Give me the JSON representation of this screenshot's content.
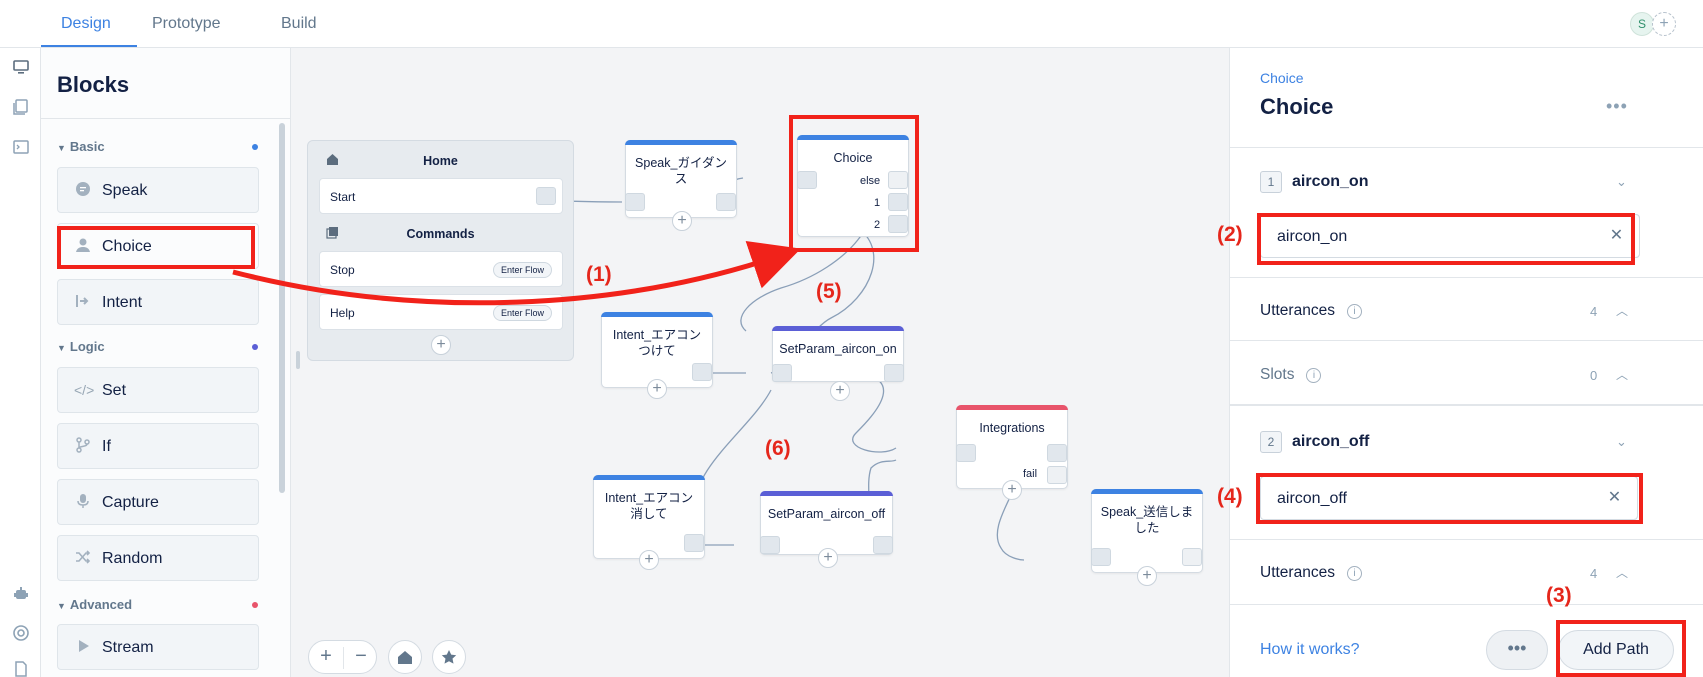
{
  "tabs": [
    {
      "label": "Design",
      "active": true
    },
    {
      "label": "Prototype",
      "active": false
    },
    {
      "label": "Build",
      "active": false
    }
  ],
  "user": {
    "initial": "S",
    "add_symbol": "+"
  },
  "blocks_panel": {
    "title": "Blocks",
    "sections": [
      {
        "label": "Basic",
        "dot_color": "#3d82e2"
      },
      {
        "label": "Logic",
        "dot_color": "#5b5fd6"
      },
      {
        "label": "Advanced",
        "dot_color": "#e8546b"
      }
    ],
    "items": [
      {
        "label": "Speak",
        "icon": "speech-bubble-icon"
      },
      {
        "label": "Choice",
        "icon": "person-icon"
      },
      {
        "label": "Intent",
        "icon": "arrow-enter-icon"
      },
      {
        "label": "Set",
        "icon": "code-icon"
      },
      {
        "label": "If",
        "icon": "branch-icon"
      },
      {
        "label": "Capture",
        "icon": "microphone-icon"
      },
      {
        "label": "Random",
        "icon": "shuffle-icon"
      },
      {
        "label": "Stream",
        "icon": "play-icon"
      }
    ]
  },
  "canvas": {
    "home": {
      "title": "Home",
      "start": "Start",
      "commands_title": "Commands",
      "commands": [
        {
          "label": "Stop",
          "button": "Enter Flow"
        },
        {
          "label": "Help",
          "button": "Enter Flow"
        }
      ]
    },
    "nodes": {
      "speak_guidance": "Speak_ガイダンス",
      "choice": "Choice",
      "choice_ports": [
        "else",
        "1",
        "2"
      ],
      "intent_on": "Intent_エアコンつけて",
      "setparam_on": "SetParam_aircon_on",
      "integrations": "Integrations",
      "integrations_fail": "fail",
      "intent_off": "Intent_エアコン消して",
      "setparam_off": "SetParam_aircon_off",
      "speak_sent": "Speak_送信しました"
    },
    "controls": {
      "zoom_in": "+",
      "zoom_out": "−"
    }
  },
  "right_panel": {
    "breadcrumb": "Choice",
    "title": "Choice",
    "more": "•••",
    "paths": [
      {
        "number": "1",
        "name": "aircon_on",
        "intent_value": "aircon_on",
        "utterances_label": "Utterances",
        "utterances_count": "4",
        "slots_label": "Slots",
        "slots_count": "0"
      },
      {
        "number": "2",
        "name": "aircon_off",
        "intent_value": "aircon_off",
        "utterances_label": "Utterances",
        "utterances_count": "4"
      }
    ],
    "how_it_works": "How it works?",
    "more_button": "•••",
    "add_path": "Add Path"
  },
  "annotations": {
    "a1": "(1)",
    "a2": "(2)",
    "a3": "(3)",
    "a4": "(4)",
    "a5": "(5)",
    "a6": "(6)",
    "color": "#f1221a"
  }
}
